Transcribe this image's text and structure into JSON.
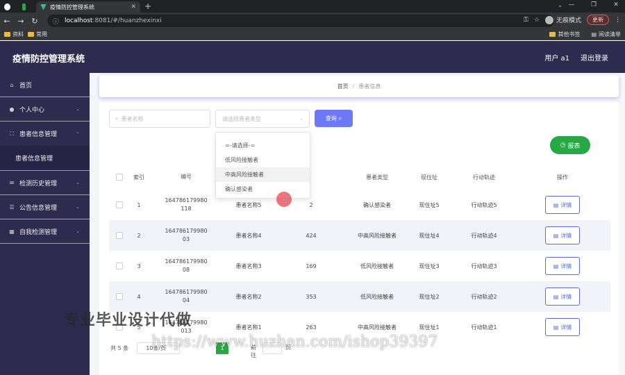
{
  "browser": {
    "tab_title": "疫情防控管理系统",
    "url_host": "localhost",
    "url_rest": ":8081/#/huanzhexinxi",
    "profile_label": "无痕模式",
    "update_label": "更新",
    "bookmarks": [
      "资料",
      "常用"
    ],
    "bookmarks_right": [
      "其他书签",
      "阅读清单"
    ]
  },
  "app": {
    "title": "疫情防控管理系统",
    "user": "用户 a1",
    "logout": "退出登录"
  },
  "sidebar": {
    "items": [
      {
        "label": "首页",
        "icon": "home-icon"
      },
      {
        "label": "个人中心",
        "icon": "user-icon"
      },
      {
        "label": "患者信息管理",
        "icon": "grid-icon"
      },
      {
        "label": "检测历史管理",
        "icon": "mail-icon"
      },
      {
        "label": "公告信息管理",
        "icon": "list-icon"
      },
      {
        "label": "自我检测管理",
        "icon": "apps-icon"
      }
    ],
    "sub_item": "患者信息管理"
  },
  "breadcrumb": {
    "home": "首页",
    "sep": "/",
    "current": "患者信息"
  },
  "search": {
    "name_placeholder": "患者名称",
    "type_placeholder": "请选择患者类型",
    "query_label": "查询",
    "report_label": "报表"
  },
  "dropdown": {
    "options": [
      "=-请选择-=",
      "低风险接触者",
      "中高风险接触者",
      "确认感染者"
    ],
    "hovered_index": 2
  },
  "table": {
    "headers": [
      "索引",
      "编号",
      "",
      "",
      "患者类型",
      "现住址",
      "行动轨迹",
      "操作"
    ],
    "detail_label": "详情",
    "rows": [
      {
        "idx": "1",
        "num1": "164786179980",
        "num2": "118",
        "name": "患者名称5",
        "age": "2",
        "type": "确认感染者",
        "addr": "现住址5",
        "track": "行动轨迹5"
      },
      {
        "idx": "2",
        "num1": "164786179980",
        "num2": "03",
        "name": "患者名称4",
        "age": "424",
        "type": "中高风险接触者",
        "addr": "现住址4",
        "track": "行动轨迹4"
      },
      {
        "idx": "3",
        "num1": "164786179980",
        "num2": "08",
        "name": "患者名称3",
        "age": "169",
        "type": "低风险接触者",
        "addr": "现住址3",
        "track": "行动轨迹3"
      },
      {
        "idx": "4",
        "num1": "164786179980",
        "num2": "04",
        "name": "患者名称2",
        "age": "353",
        "type": "低风险接触者",
        "addr": "现住址2",
        "track": "行动轨迹2"
      },
      {
        "idx": "5",
        "num1": "164786179980",
        "num2": "013",
        "name": "患者名称1",
        "age": "263",
        "type": "中高风险接触者",
        "addr": "现住址1",
        "track": "行动轨迹1"
      }
    ]
  },
  "pagination": {
    "total": "共 5 条",
    "page_size": "10条/页",
    "current": "1",
    "goto": "前往",
    "page_unit": "页"
  },
  "watermark": {
    "line1": "专业毕业设计代做",
    "line2": "https://www.huzhan.com/ishop39397"
  },
  "colors": {
    "sidebar_bg": "#2d2b4e",
    "primary": "#6e79f5",
    "success": "#27a845"
  }
}
